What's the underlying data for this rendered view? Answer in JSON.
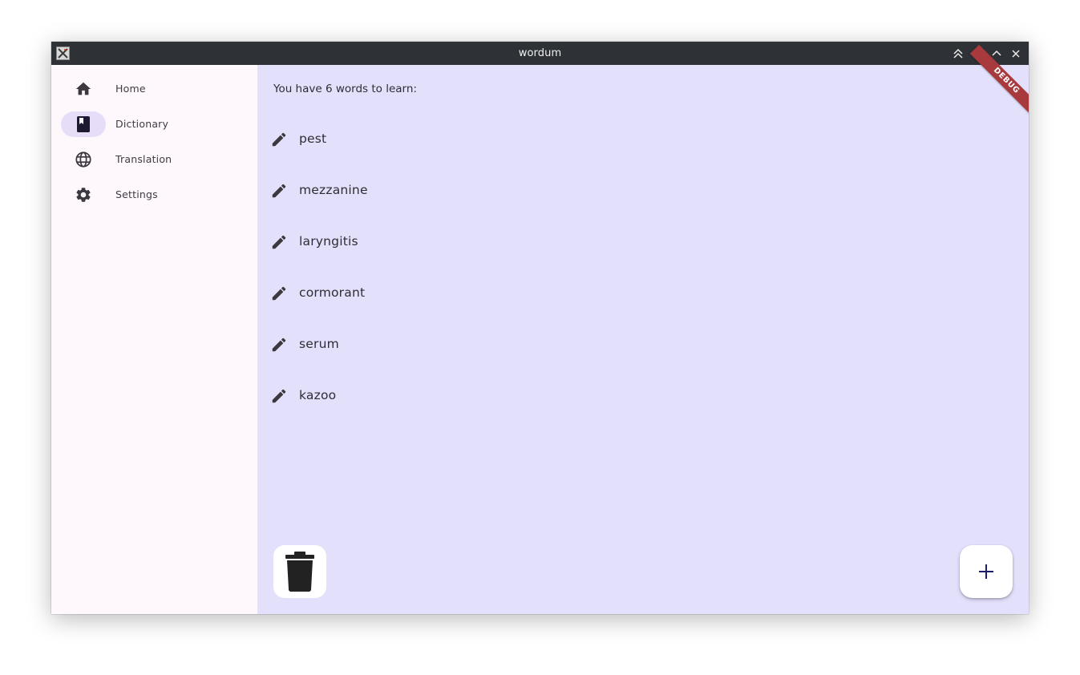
{
  "window": {
    "title": "wordum",
    "controls": [
      "keep-above-icon",
      "minimize-icon",
      "maximize-icon",
      "close-icon"
    ]
  },
  "sidebar": {
    "items": [
      {
        "label": "Home",
        "icon": "home-icon",
        "active": false
      },
      {
        "label": "Dictionary",
        "icon": "book-icon",
        "active": true
      },
      {
        "label": "Translation",
        "icon": "globe-icon",
        "active": false
      },
      {
        "label": "Settings",
        "icon": "gear-icon",
        "active": false
      }
    ]
  },
  "main": {
    "header": "You have 6 words to learn:",
    "words": [
      "pest",
      "mezzanine",
      "laryngitis",
      "cormorant",
      "serum",
      "kazoo"
    ],
    "debug_banner": "DEBUG"
  },
  "colors": {
    "titlebar": "#2e3236",
    "sidebar_bg": "#fef7fc",
    "main_bg": "#e3e0fc",
    "active_indicator": "#e6def8",
    "debug_banner": "#a83a3e",
    "fab_icon": "#1f1b6b"
  }
}
